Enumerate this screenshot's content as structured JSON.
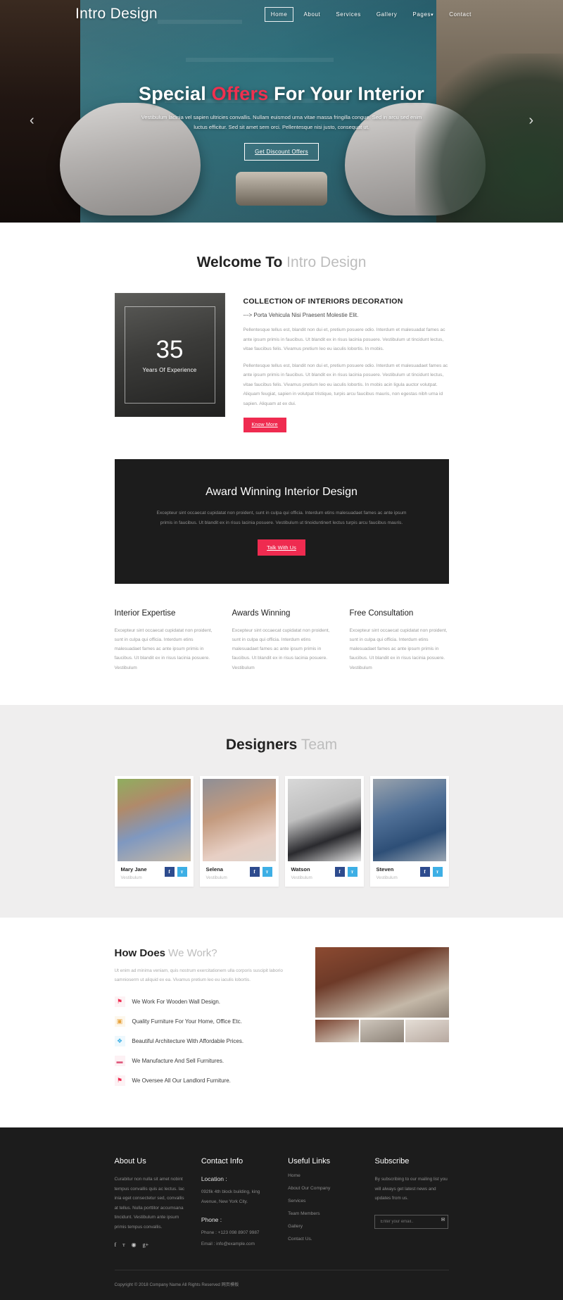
{
  "brand": "Intro Design",
  "nav": {
    "items": [
      {
        "label": "Home",
        "active": true
      },
      {
        "label": "About",
        "active": false
      },
      {
        "label": "Services",
        "active": false
      },
      {
        "label": "Gallery",
        "active": false
      },
      {
        "label": "Pages",
        "active": false,
        "caret": "▾"
      },
      {
        "label": "Contact",
        "active": false
      }
    ]
  },
  "hero": {
    "title_part1": "Special ",
    "title_accent": "Offers",
    "title_part2": " For Your Interior",
    "subtitle": "Vestibulum lacinia vel sapien ultricies convallis. Nullam euismod urna vitae massa fringilla congue. Sed in arcu sed enim luctus efficitur. Sed sit amet sem orci. Pellentesque nisi justo, consequat ut.",
    "button": "Get Discount Offers",
    "prev_arrow": "‹",
    "next_arrow": "›"
  },
  "welcome": {
    "title_bold": "Welcome To",
    "title_light": " Intro Design",
    "experience_number": "35",
    "experience_caption": "Years Of Experience",
    "heading": "COLLECTION OF INTERIORS DECORATION",
    "subheading": "---> Porta Vehicula Nisi Praesent Molestie Elit.",
    "paragraph1": "Pellentesque tellus est, blandit non dui et, pretium posuere odio. Interdum et malesuadat fames ac ante ipsum primis in faucibus. Ut blandit ex in risus lacinia posuere. Vestibulum ut tincidunt lectus, vitae faucibus felis. Vivamus pretium leo eu iaculis lobortis. In mobis.",
    "paragraph2": "Pellentesque tellus est, blandit non dui et, pretium posuere odio. Interdum et malesuadaet fames ac ante ipsum primis in faucibus. Ut blandit ex in risus lacinia posuere. Vestibulum ut tincidunt lectus, vitae faucibus felis. Vivamus pretium leo eu iaculis lobortis. In mobis acin ligula auctor volutpat. Aliquam feugiat, sapien in volutpat tristique, turpis arcu faucibus mauris, non egestas nibh urna id sapien. Aliquam at ex dui.",
    "button": "Know More"
  },
  "award": {
    "heading": "Award Winning Interior Design",
    "paragraph": "Excepteur sint occaecat cupidatat non proident, sunt in culpa qui officia. Interdum etins malesuadaet fames ac ante ipsum primis in faucibus. Ut blandit ex in risus lacinia posuere. Vestibulum ut tinoiduntinert lectus turpis arcu faucibus mauris.",
    "button": "Talk With Us"
  },
  "features": [
    {
      "title": "Interior Expertise",
      "text": "Excepteur sint occaecat cupidatat non proident, sunt in culpa qui officia. Interdum etins malesuadaet fames ac ante ipsum primis in faucibus. Ut blandit ex in risus lacinia posuere. Vestibulum"
    },
    {
      "title": "Awards Winning",
      "text": "Excepteur sint occaecat cupidatat non proident, sunt in culpa qui officia. Interdum etins malesuadaet fames ac ante ipsum primis in faucibus. Ut blandit ex in risus lacinia posuere. Vestibulum"
    },
    {
      "title": "Free Consultation",
      "text": "Excepteur sint occaecat cupidatat non proident, sunt in culpa qui officia. Interdum etins malesuadaet fames ac ante ipsum primis in faucibus. Ut blandit ex in risus lacinia posuere. Vestibulum"
    }
  ],
  "team": {
    "title_bold": "Designers",
    "title_light": " Team",
    "members": [
      {
        "name": "Mary Jane",
        "role": "Vestibulum",
        "fb": "f",
        "tw": "ᴛ"
      },
      {
        "name": "Selena",
        "role": "Vestibulum",
        "fb": "f",
        "tw": "ᴛ"
      },
      {
        "name": "Watson",
        "role": "Vestibulum",
        "fb": "f",
        "tw": "ᴛ"
      },
      {
        "name": "Steven",
        "role": "Vestibulum",
        "fb": "f",
        "tw": "ᴛ"
      }
    ]
  },
  "how": {
    "title_bold": "How Does",
    "title_light": " We Work?",
    "paragraph": "Ut enim ad minima veniam, quis nostrum exercitationem ulla corporis suscipit laborio samnioserm ut aliquid ex ea. Vivamus pretium leo eu iaculis lobortis.",
    "items": [
      {
        "icon": "⚑",
        "text": "We Work For Wooden Wall Design."
      },
      {
        "icon": "▣",
        "text": "Quality Furniture For Your Home, Office Etc."
      },
      {
        "icon": "❖",
        "text": "Beautiful Architecture With Affordable Prices."
      },
      {
        "icon": "▬",
        "text": "We Manufacture And Sell Furnitures."
      },
      {
        "icon": "⚑",
        "text": "We Oversee All Our Landlord Furniture."
      }
    ]
  },
  "footer": {
    "about": {
      "title": "About Us",
      "text": "Curabitur non nulla sit amet nobint tempus convallis quis ac lectus. lac inia eget consectetur sed, convallis at tellus. Nulla porttitor accumsana tincidunt. Vestibulum ante ipsum primis tempus convallis.",
      "socials": [
        "f",
        "ᴛ",
        "◉",
        "g+"
      ]
    },
    "contact": {
      "title": "Contact Info",
      "location_label": "Location :",
      "location_value": "092fik 4th block building, king Avenue, New York City.",
      "phone_label": "Phone :",
      "phone_value": "Phone : +123 098 8907 9987",
      "email_value": "Email : info@example.com"
    },
    "useful": {
      "title": "Useful Links",
      "links": [
        "Home",
        "About Our Company",
        "Services",
        "Team Members",
        "Gallery",
        "Contact Us."
      ]
    },
    "subscribe": {
      "title": "Subscribe",
      "text": "By subscribing to our mailing list you will always get latest news and updates from us.",
      "placeholder": "Enter your email..",
      "send_icon": "✉"
    },
    "copyright": "Copyright © 2018 Company Name All Rights Reserved 网页模板"
  },
  "colors": {
    "accent": "#ef2b50",
    "hero_accent": "#f0304f",
    "dark": "#1c1c1c",
    "team_bg": "#efeeee"
  }
}
